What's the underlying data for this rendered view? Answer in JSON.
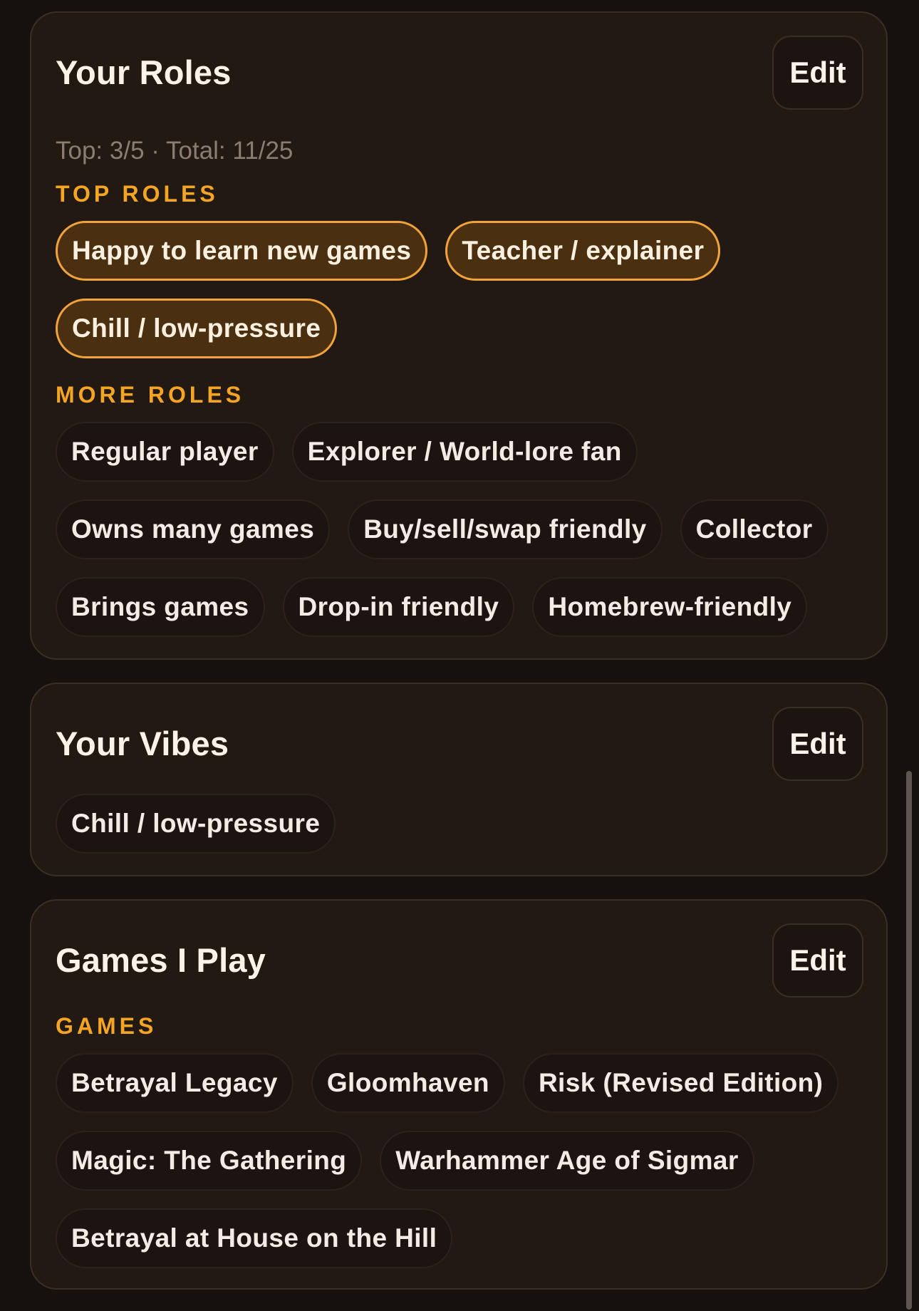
{
  "roles": {
    "title": "Your Roles",
    "edit_label": "Edit",
    "counts": "Top: 3/5 · Total: 11/25",
    "top_label": "TOP ROLES",
    "top_rows": [
      [
        "Happy to learn new games",
        "Teacher / explainer"
      ],
      [
        "Chill / low-pressure"
      ]
    ],
    "more_label": "MORE ROLES",
    "more_rows": [
      [
        "Regular player",
        "Explorer / World-lore fan"
      ],
      [
        "Owns many games",
        "Buy/sell/swap friendly",
        "Collector"
      ],
      [
        "Brings games",
        "Drop-in friendly",
        "Homebrew-friendly"
      ]
    ]
  },
  "vibes": {
    "title": "Your Vibes",
    "edit_label": "Edit",
    "rows": [
      [
        "Chill / low-pressure"
      ]
    ]
  },
  "games": {
    "title": "Games I Play",
    "edit_label": "Edit",
    "section_label": "GAMES",
    "rows": [
      [
        "Betrayal Legacy",
        "Gloomhaven",
        "Risk (Revised Edition)"
      ],
      [
        "Magic: The Gathering",
        "Warhammer Age of Sigmar"
      ],
      [
        "Betrayal at House on the Hill"
      ]
    ]
  },
  "colors": {
    "background": "#16110e",
    "card": "#221912",
    "accent": "#f5a524",
    "top_chip_fill": "#4a3010",
    "top_chip_border": "#f0a33a"
  }
}
